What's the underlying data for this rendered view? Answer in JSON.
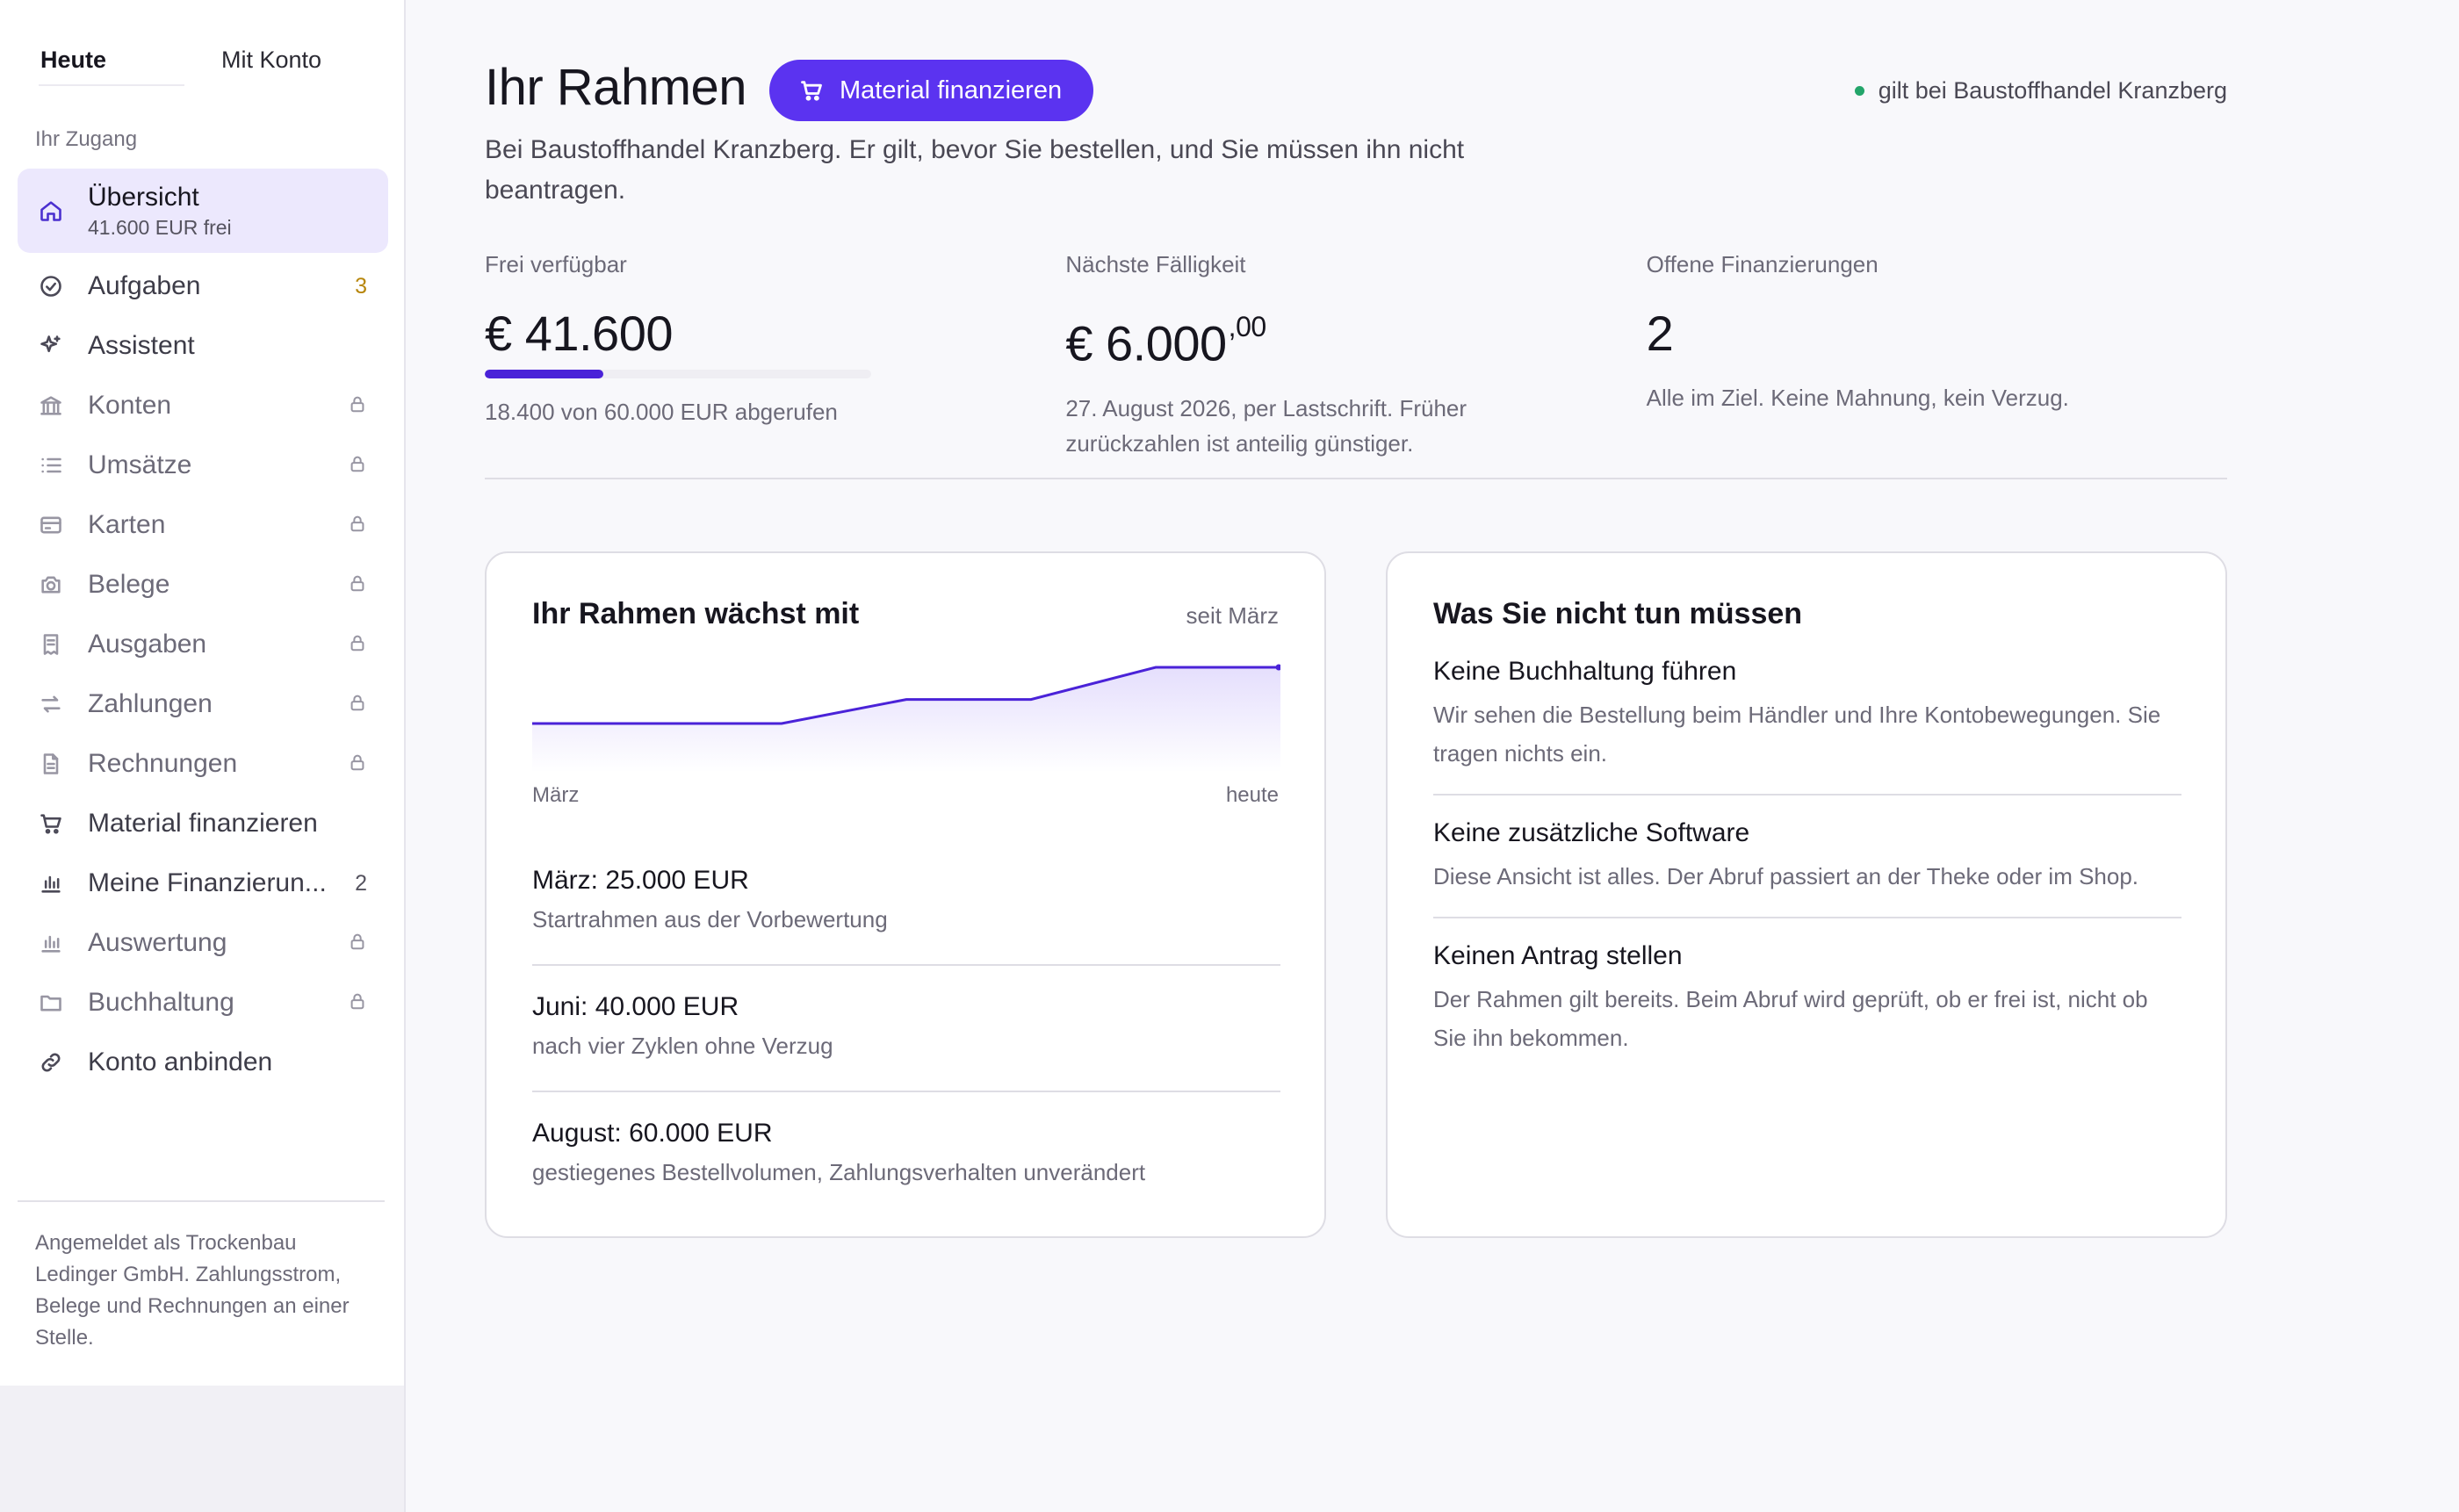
{
  "sidebar": {
    "tabs": [
      {
        "label": "Heute",
        "active": true
      },
      {
        "label": "Mit Konto",
        "active": false
      }
    ],
    "section_label": "Ihr Zugang",
    "items": [
      {
        "label": "Übersicht",
        "sub": "41.600 EUR frei",
        "icon": "home-icon",
        "active": true
      },
      {
        "label": "Aufgaben",
        "badge": "3",
        "icon": "check-circle-icon"
      },
      {
        "label": "Assistent",
        "icon": "sparkle-icon"
      },
      {
        "label": "Konten",
        "icon": "bank-icon",
        "locked": true
      },
      {
        "label": "Umsätze",
        "icon": "list-icon",
        "locked": true
      },
      {
        "label": "Karten",
        "icon": "card-icon",
        "locked": true
      },
      {
        "label": "Belege",
        "icon": "camera-icon",
        "locked": true
      },
      {
        "label": "Ausgaben",
        "icon": "receipt-icon",
        "locked": true
      },
      {
        "label": "Zahlungen",
        "icon": "transfer-icon",
        "locked": true
      },
      {
        "label": "Rechnungen",
        "icon": "document-icon",
        "locked": true
      },
      {
        "label": "Material finanzieren",
        "icon": "cart-icon"
      },
      {
        "label": "Meine Finanzierun...",
        "badge": "2",
        "icon": "bar-chart-icon"
      },
      {
        "label": "Auswertung",
        "icon": "bar-chart-icon",
        "locked": true
      },
      {
        "label": "Buchhaltung",
        "icon": "folder-icon",
        "locked": true
      },
      {
        "label": "Konto anbinden",
        "icon": "link-icon"
      }
    ],
    "footer": "Angemeldet als Trockenbau Ledinger GmbH. Zahlungsstrom, Belege und Rechnungen an einer Stelle."
  },
  "header": {
    "title": "Ihr Rahmen",
    "cta_label": "Material finanzieren",
    "merchant_status": "gilt bei Baustoffhandel Kranzberg",
    "intro": "Bei Baustoffhandel Kranzberg. Er gilt, bevor Sie bestellen, und Sie müssen ihn nicht beantragen."
  },
  "stats": {
    "available": {
      "label": "Frei verfügbar",
      "value": "€ 41.600",
      "progress_fraction": 0.307,
      "note": "18.400 von 60.000 EUR abgerufen"
    },
    "due": {
      "label": "Nächste Fälligkeit",
      "value": "€ 6.000",
      "value_cents": ",00",
      "note": "27. August 2026, per Lastschrift. Früher zurückzahlen ist anteilig günstiger."
    },
    "open": {
      "label": "Offene Finanzierungen",
      "value": "2",
      "note": "Alle im Ziel. Keine Mahnung, kein Verzug."
    }
  },
  "growth_card": {
    "title": "Ihr Rahmen wächst mit",
    "meta": "seit März",
    "axis_start": "März",
    "axis_end": "heute",
    "milestones": [
      {
        "title": "März: 25.000 EUR",
        "desc": "Startrahmen aus der Vorbewertung"
      },
      {
        "title": "Juni: 40.000 EUR",
        "desc": "nach vier Zyklen ohne Verzug"
      },
      {
        "title": "August: 60.000 EUR",
        "desc": "gestiegenes Bestellvolumen, Zahlungsverhalten unverändert"
      }
    ]
  },
  "chart_data": {
    "type": "area",
    "values": [
      25000,
      25000,
      25000,
      40000,
      40000,
      60000,
      60000
    ],
    "ylim": [
      0,
      60000
    ],
    "color": "#4a22d8"
  },
  "tips_card": {
    "title": "Was Sie nicht tun müssen",
    "items": [
      {
        "title": "Keine Buchhaltung führen",
        "desc": "Wir sehen die Bestellung beim Händler und Ihre Kontobewegungen. Sie tragen nichts ein."
      },
      {
        "title": "Keine zusätzliche Software",
        "desc": "Diese Ansicht ist alles. Der Abruf passiert an der Theke oder im Shop."
      },
      {
        "title": "Keinen Antrag stellen",
        "desc": "Der Rahmen gilt bereits. Beim Abruf wird geprüft, ob er frei ist, nicht ob Sie ihn bekommen."
      }
    ]
  },
  "colors": {
    "accent": "#5b33f0",
    "active_nav_bg": "#ece8fd",
    "status_green": "#23a56a",
    "badge_warn": "#b7860b"
  }
}
